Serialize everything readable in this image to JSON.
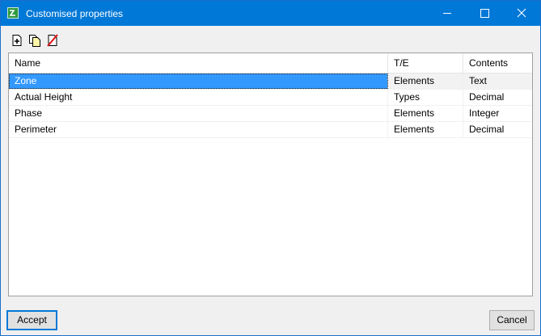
{
  "window": {
    "title": "Customised properties",
    "accent": "#0078d7"
  },
  "toolbar": {
    "buttons": [
      {
        "icon": "add-document-icon",
        "label": "Add"
      },
      {
        "icon": "copy-document-icon",
        "label": "Copy"
      },
      {
        "icon": "delete-icon",
        "label": "Delete"
      }
    ]
  },
  "table": {
    "headers": {
      "name": "Name",
      "te": "T/E",
      "contents": "Contents"
    },
    "rows": [
      {
        "name": "Zone",
        "te": "Elements",
        "contents": "Text",
        "selected": true
      },
      {
        "name": "Actual Height",
        "te": "Types",
        "contents": "Decimal"
      },
      {
        "name": "Phase",
        "te": "Elements",
        "contents": "Integer"
      },
      {
        "name": "Perimeter",
        "te": "Elements",
        "contents": "Decimal"
      }
    ],
    "selection_color": "#3399ff"
  },
  "footer": {
    "accept_label": "Accept",
    "cancel_label": "Cancel"
  }
}
